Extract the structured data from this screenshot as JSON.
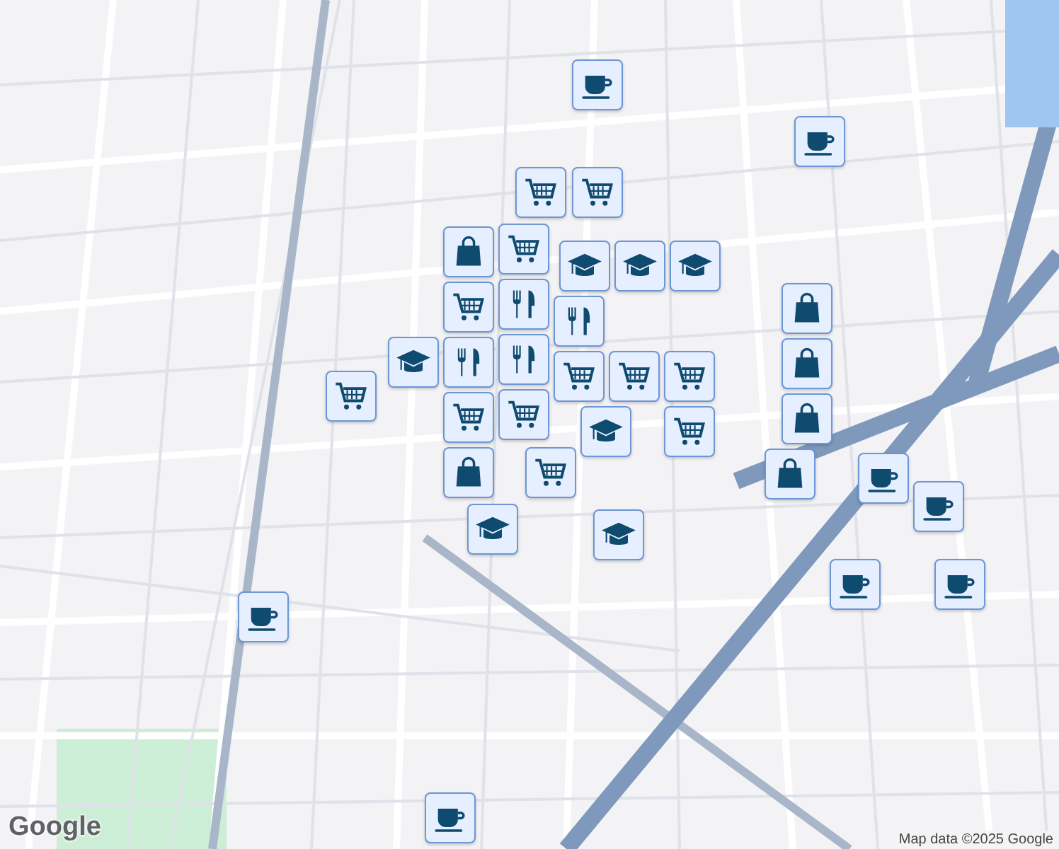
{
  "map": {
    "markers": [
      {
        "kind": "coffee"
      },
      {
        "kind": "coffee"
      },
      {
        "kind": "cart"
      },
      {
        "kind": "cart"
      },
      {
        "kind": "bag"
      },
      {
        "kind": "cart"
      },
      {
        "kind": "school"
      },
      {
        "kind": "school"
      },
      {
        "kind": "school"
      },
      {
        "kind": "food"
      },
      {
        "kind": "food"
      },
      {
        "kind": "cart"
      },
      {
        "kind": "school"
      },
      {
        "kind": "food"
      },
      {
        "kind": "food"
      },
      {
        "kind": "cart"
      },
      {
        "kind": "cart"
      },
      {
        "kind": "cart"
      },
      {
        "kind": "bag"
      },
      {
        "kind": "bag"
      },
      {
        "kind": "bag"
      },
      {
        "kind": "bag"
      },
      {
        "kind": "school"
      },
      {
        "kind": "cart"
      },
      {
        "kind": "cart"
      },
      {
        "kind": "cart"
      },
      {
        "kind": "cart"
      },
      {
        "kind": "bag"
      },
      {
        "kind": "coffee"
      },
      {
        "kind": "coffee"
      },
      {
        "kind": "cart"
      },
      {
        "kind": "school"
      },
      {
        "kind": "school"
      },
      {
        "kind": "coffee"
      },
      {
        "kind": "coffee"
      },
      {
        "kind": "coffee"
      },
      {
        "kind": "coffee"
      }
    ]
  },
  "logo": "Google",
  "attribution": "Map data ©2025 Google"
}
